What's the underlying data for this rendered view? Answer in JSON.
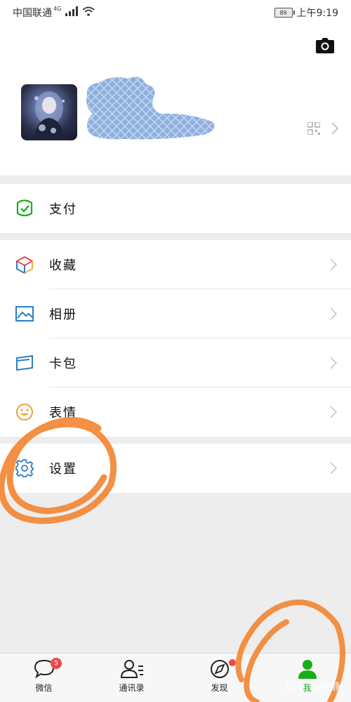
{
  "status_bar": {
    "carrier": "中国联通",
    "network": "4G",
    "battery": "89",
    "time": "上午9:19"
  },
  "profile": {
    "camera_icon": "camera-icon",
    "qr_icon": "qr-code-icon"
  },
  "menu": {
    "pay": {
      "label": "支付",
      "icon": "wallet-check-icon",
      "color": "#1aad19"
    },
    "favorites": {
      "label": "收藏",
      "icon": "cube-icon"
    },
    "album": {
      "label": "相册",
      "icon": "image-icon",
      "color": "#2a7fc4"
    },
    "cards": {
      "label": "卡包",
      "icon": "card-icon",
      "color": "#2a7fc4"
    },
    "stickers": {
      "label": "表情",
      "icon": "smiley-icon",
      "color": "#e6a23c"
    },
    "settings": {
      "label": "设置",
      "icon": "gear-icon",
      "color": "#2a7fc4"
    }
  },
  "tabbar": {
    "tabs": [
      {
        "label": "微信",
        "icon": "chat-bubble-icon",
        "badge": "5"
      },
      {
        "label": "通讯录",
        "icon": "contacts-icon"
      },
      {
        "label": "发现",
        "icon": "compass-icon"
      },
      {
        "label": "我",
        "icon": "person-icon",
        "active": true
      }
    ]
  },
  "watermark": "知乎 @恬静",
  "colors": {
    "accent": "#1aad19",
    "annotation": "#f28a3a",
    "badge": "#f04848"
  }
}
